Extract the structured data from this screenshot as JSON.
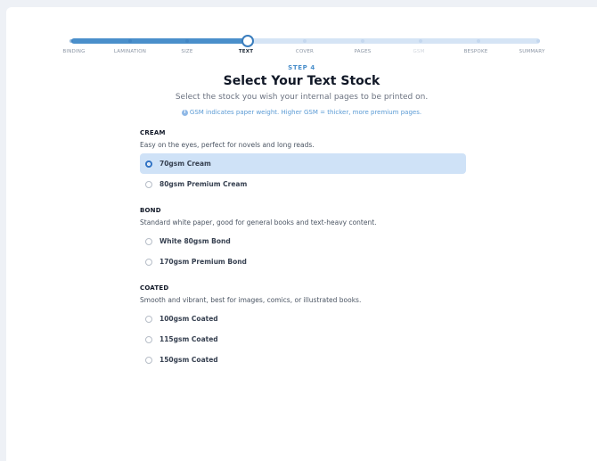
{
  "stepper": {
    "steps": [
      {
        "label": "BINDING",
        "state": "done"
      },
      {
        "label": "LAMINATION",
        "state": "done"
      },
      {
        "label": "SIZE",
        "state": "done"
      },
      {
        "label": "TEXT",
        "state": "current"
      },
      {
        "label": "COVER",
        "state": "future"
      },
      {
        "label": "PAGES",
        "state": "future"
      },
      {
        "label": "GSM",
        "state": "disabled"
      },
      {
        "label": "BESPOKE",
        "state": "future"
      },
      {
        "label": "SUMMARY",
        "state": "future"
      }
    ]
  },
  "header": {
    "kicker": "STEP 4",
    "title": "Select Your Text Stock",
    "subtitle": "Select the stock you wish your internal pages to be printed on.",
    "hint": "GSM indicates paper weight. Higher GSM = thicker, more premium pages.",
    "hint_icon": "info-icon"
  },
  "groups": [
    {
      "title": "CREAM",
      "description": "Easy on the eyes, perfect for novels and long reads.",
      "options": [
        {
          "label": "70gsm Cream",
          "selected": true
        },
        {
          "label": "80gsm Premium Cream",
          "selected": false
        }
      ]
    },
    {
      "title": "BOND",
      "description": "Standard white paper, good for general books and text-heavy content.",
      "options": [
        {
          "label": "White 80gsm Bond",
          "selected": false
        },
        {
          "label": "170gsm Premium Bond",
          "selected": false
        }
      ]
    },
    {
      "title": "COATED",
      "description": "Smooth and vibrant, best for images, comics, or illustrated books.",
      "options": [
        {
          "label": "100gsm Coated",
          "selected": false
        },
        {
          "label": "115gsm Coated",
          "selected": false
        },
        {
          "label": "150gsm Coated",
          "selected": false
        }
      ]
    }
  ],
  "colors": {
    "accent": "#3a7dbd",
    "selected_bg": "#cfe2f7"
  }
}
